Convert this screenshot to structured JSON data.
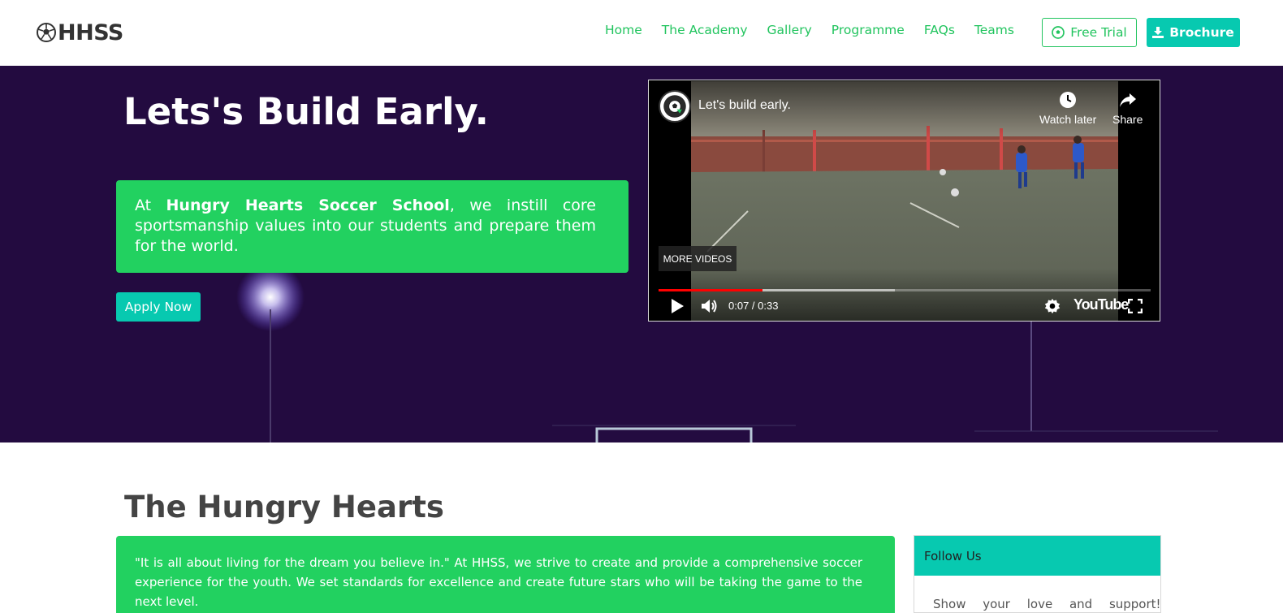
{
  "brand": {
    "name": "HHSS"
  },
  "nav": {
    "items": [
      "Home",
      "The Academy",
      "Gallery",
      "Programme",
      "FAQs",
      "Teams"
    ],
    "free_trial": "Free Trial",
    "brochure": "Brochure"
  },
  "hero": {
    "title": "Lets's Build Early.",
    "intro_prefix": "At ",
    "intro_school": "Hungry Hearts Soccer School",
    "intro_suffix": ", we instill core sportsmanship values into our students and prepare them for the world.",
    "apply": "Apply Now"
  },
  "video": {
    "title": "Let's build early.",
    "watch_later": "Watch later",
    "share": "Share",
    "more_videos": "MORE VIDEOS",
    "time": "0:07 / 0:33",
    "brand": "YouTube",
    "progress_fraction": 0.212
  },
  "about": {
    "title": "The Hungry Hearts",
    "text": "\"It is all about living for the dream you believe in.\" At HHSS, we strive to create and provide a comprehensive soccer experience for the youth. We set standards for excellence and create future stars who will be taking the game to the next level."
  },
  "follow": {
    "title": "Follow Us",
    "text": "Show your love and support!"
  },
  "colors": {
    "green": "#22d160",
    "teal": "#07c9b0",
    "hero_bg": "#230b40",
    "link": "#21c45e"
  }
}
